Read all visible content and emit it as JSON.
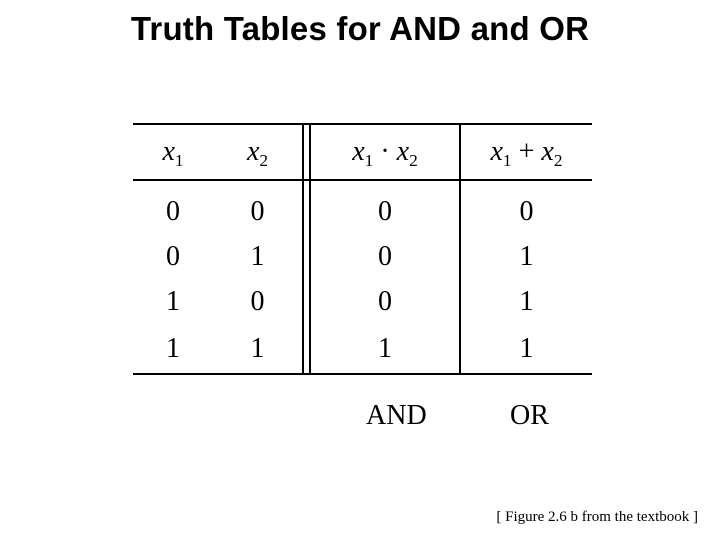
{
  "title": "Truth Tables for AND  and  OR",
  "vars": {
    "x1": "x",
    "x1sub": "1",
    "x2": "x",
    "x2sub": "2"
  },
  "ops": {
    "dot": " · ",
    "plus": " + "
  },
  "rows": [
    {
      "x1": "0",
      "x2": "0",
      "and": "0",
      "or": "0"
    },
    {
      "x1": "0",
      "x2": "1",
      "and": "0",
      "or": "1"
    },
    {
      "x1": "1",
      "x2": "0",
      "and": "0",
      "or": "1"
    },
    {
      "x1": "1",
      "x2": "1",
      "and": "1",
      "or": "1"
    }
  ],
  "labels": {
    "and": "AND",
    "or": "OR"
  },
  "caption": "[ Figure 2.6 b from the textbook ]",
  "chart_data": {
    "type": "table",
    "title": "Truth Tables for AND and OR",
    "columns": [
      "x1",
      "x2",
      "x1 · x2",
      "x1 + x2"
    ],
    "rows": [
      [
        0,
        0,
        0,
        0
      ],
      [
        0,
        1,
        0,
        1
      ],
      [
        1,
        0,
        0,
        1
      ],
      [
        1,
        1,
        1,
        1
      ]
    ],
    "column_labels": [
      "",
      "",
      "AND",
      "OR"
    ]
  }
}
